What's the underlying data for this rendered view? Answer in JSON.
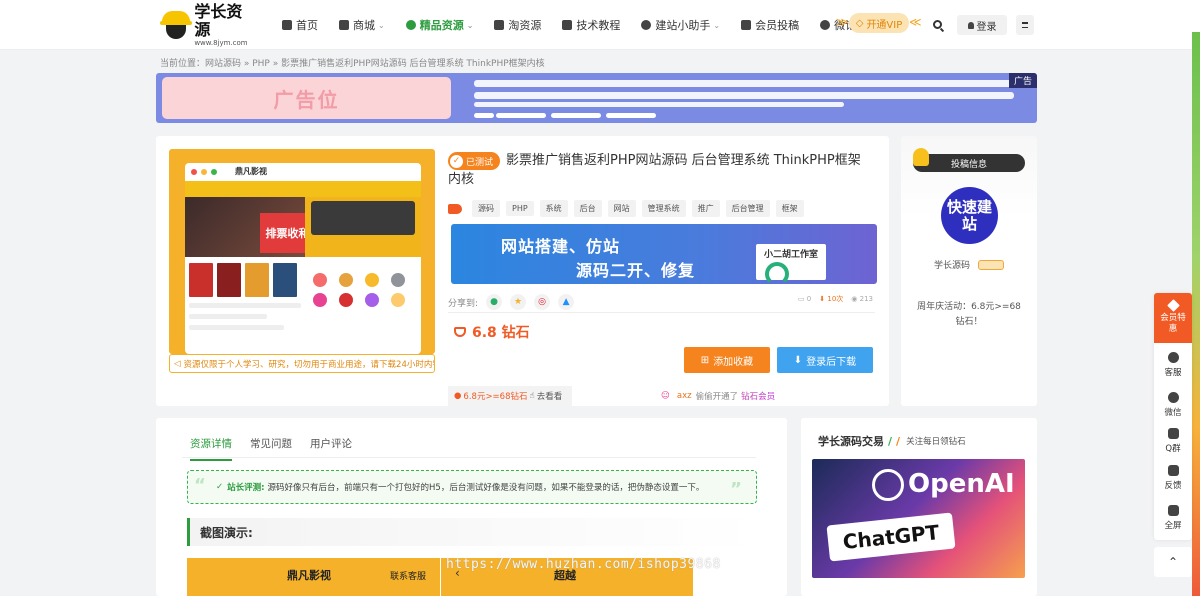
{
  "header": {
    "logo_title": "学长资源",
    "logo_sub": "www.8jym.com",
    "nav": [
      {
        "label": "首页",
        "icon": "home-icon",
        "caret": false,
        "active": false
      },
      {
        "label": "商城",
        "icon": "grid-icon",
        "caret": true,
        "active": false
      },
      {
        "label": "精品资源",
        "icon": "globe-icon",
        "caret": true,
        "active": true
      },
      {
        "label": "淘资源",
        "icon": "inbox-icon",
        "caret": false,
        "active": false
      },
      {
        "label": "技术教程",
        "icon": "graduation-cap-icon",
        "caret": false,
        "active": false
      },
      {
        "label": "建站小助手",
        "icon": "question-icon",
        "caret": true,
        "active": false
      },
      {
        "label": "会员投稿",
        "icon": "book-icon",
        "caret": false,
        "active": false
      },
      {
        "label": "微论坛",
        "icon": "chat-icon",
        "caret": false,
        "active": false
      }
    ],
    "vip_label": "开通VIP",
    "login_label": "登录"
  },
  "breadcrumb": "当前位置：网站源码 » PHP » 影票推广销售返利PHP网站源码 后台管理系统 ThinkPHP框架内核",
  "ad": {
    "left_text": "广告位",
    "tag": "广告"
  },
  "product": {
    "badge": "已测试",
    "title": "影票推广销售返利PHP网站源码 后台管理系统 ThinkPHP框架内核",
    "tags": [
      "源码",
      "PHP",
      "系统",
      "后台",
      "网站",
      "管理系统",
      "推广",
      "后台管理",
      "框架"
    ],
    "thumb": {
      "app_name": "鼎凡影视",
      "promo": "排票收和"
    },
    "notice": "资源仅限于个人学习、研究，切勿用于商业用途，请下载24小时内销毁!",
    "promo_banner": {
      "line1": "网站搭建、仿站",
      "line2": "源码二开、修复",
      "studio": "小二胡工作室"
    },
    "share_label": "分享到:",
    "stats": {
      "comments": "0",
      "downloads": "10次",
      "views": "213"
    },
    "price": "6.8 钻石",
    "fav_label": "添加收藏",
    "download_label": "登录后下载",
    "sub_price": "6.8元>=68钻石",
    "sub_action": "去看看",
    "ticker_user": "axz",
    "ticker_text": "偷偷开通了",
    "ticker_vip": "钻石会员"
  },
  "author": {
    "head": "投稿信息",
    "avatar_text": "快速建站",
    "name": "学长源码",
    "promo": "周年庆活动：6.8元>=68钻石！"
  },
  "content": {
    "tabs": [
      {
        "label": "资源详情",
        "active": true
      },
      {
        "label": "常见问题",
        "active": false
      },
      {
        "label": "用户评论",
        "active": false
      }
    ],
    "review_label": "站长评测:",
    "review_text": "源码好像只有后台，前端只有一个打包好的H5，后台测试好像是没有问题，如果不能登录的话，把伪静态设置一下。",
    "demo_heading": "截图演示:",
    "demo_title1": "鼎凡影视",
    "demo_link1": "联系客服",
    "demo_title2": "超越",
    "watermark": "https://www.huzhan.com/ishop39868"
  },
  "widget": {
    "title": "学长源码交易",
    "sub": "关注每日领钻石",
    "openai": "OpenAI",
    "chatgpt": "ChatGPT"
  },
  "float_bar": [
    {
      "label": "会员特惠",
      "icon": "diamond-icon"
    },
    {
      "label": "客服",
      "icon": "qq-icon"
    },
    {
      "label": "微信",
      "icon": "wechat-icon"
    },
    {
      "label": "Q群",
      "icon": "group-icon"
    },
    {
      "label": "反馈",
      "icon": "edit-icon"
    },
    {
      "label": "全屏",
      "icon": "fullscreen-icon"
    }
  ]
}
